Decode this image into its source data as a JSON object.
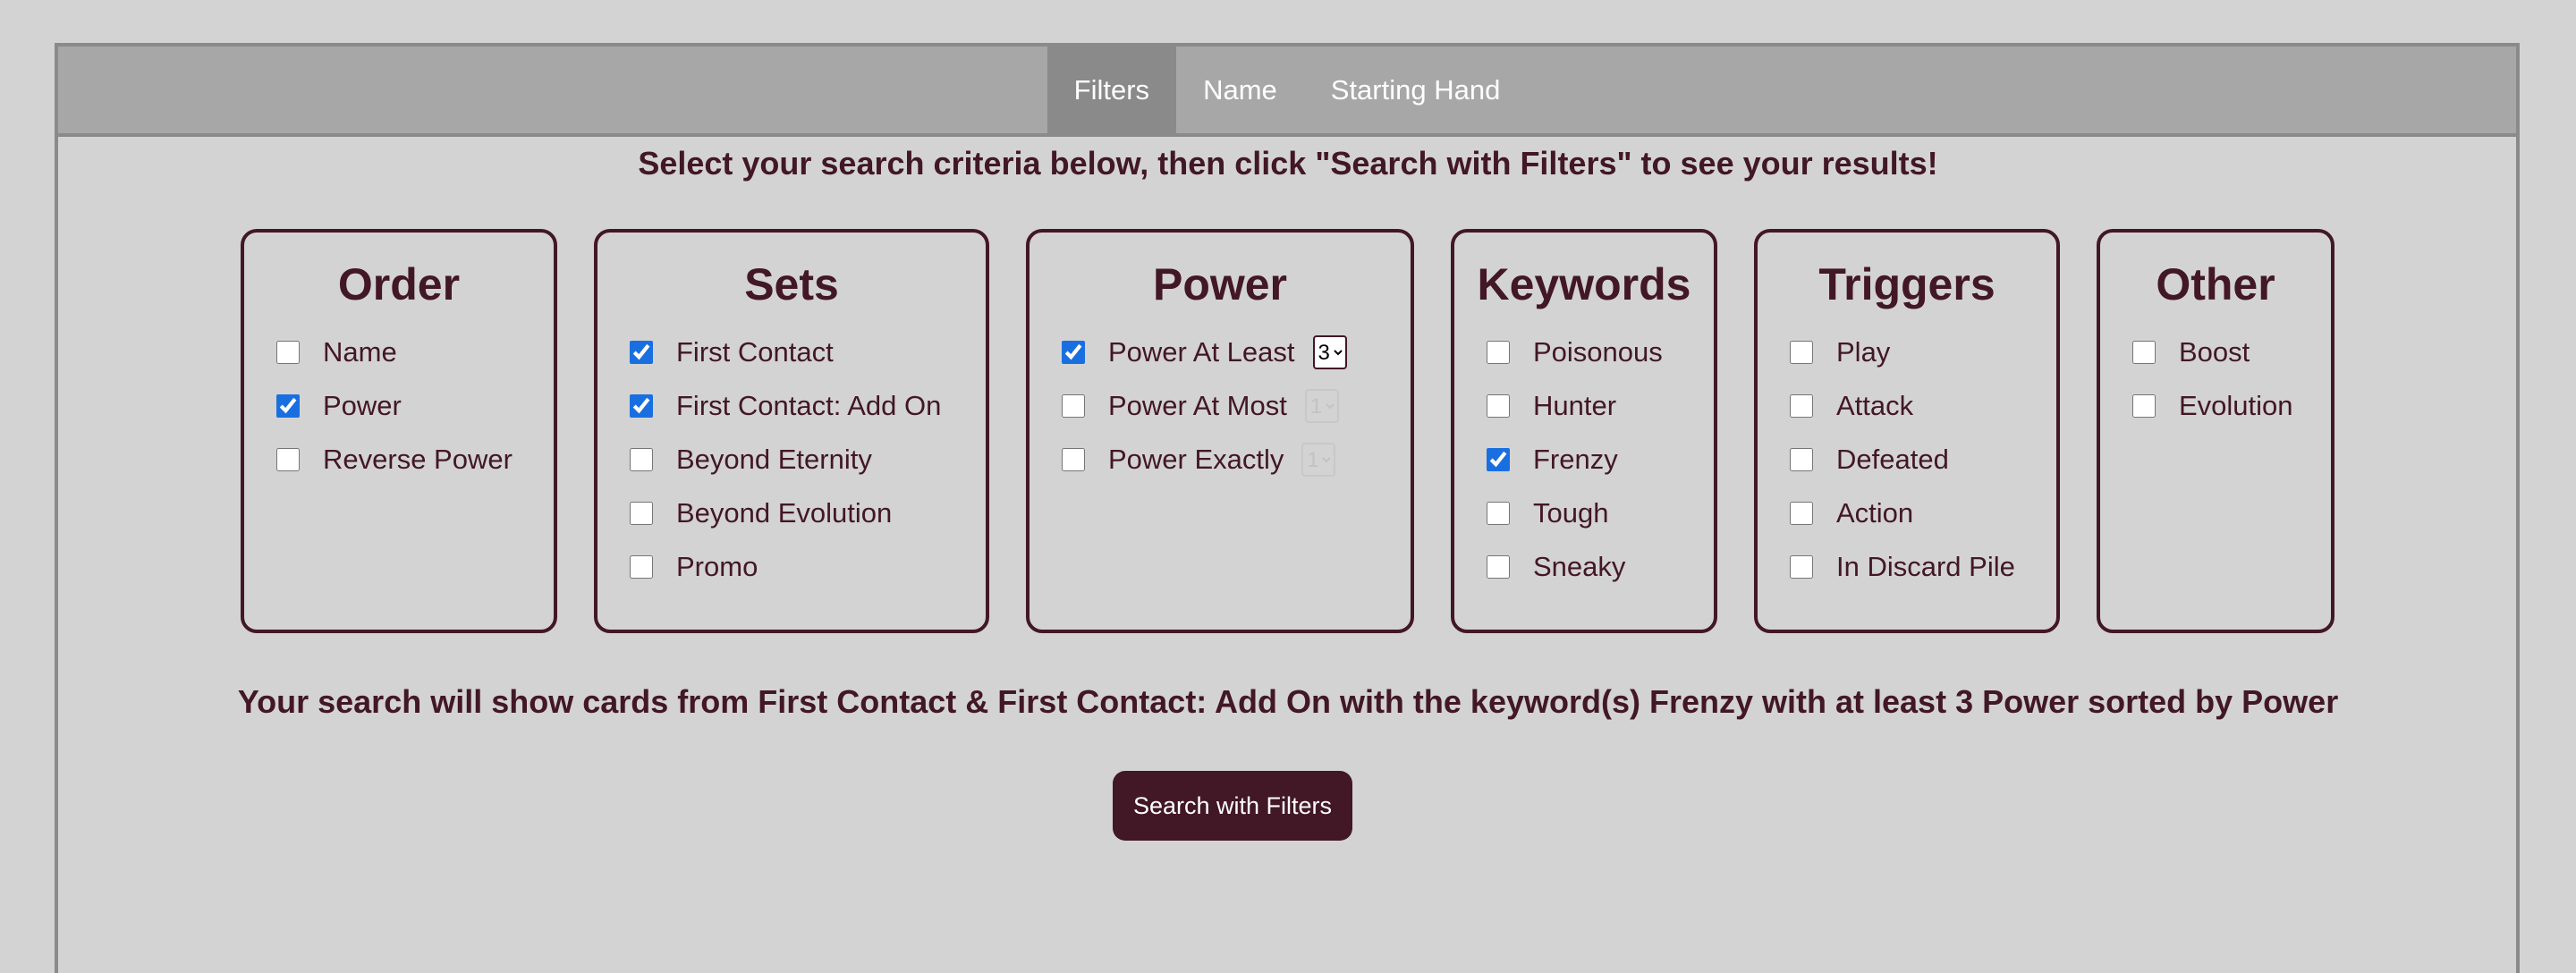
{
  "tabs": [
    {
      "label": "Filters",
      "active": true
    },
    {
      "label": "Name",
      "active": false
    },
    {
      "label": "Starting Hand",
      "active": false
    }
  ],
  "instructions": "Select your search criteria below, then click \"Search with Filters\" to see your results!",
  "panels": {
    "order": {
      "title": "Order",
      "options": [
        {
          "label": "Name",
          "checked": false
        },
        {
          "label": "Power",
          "checked": true
        },
        {
          "label": "Reverse Power",
          "checked": false
        }
      ]
    },
    "sets": {
      "title": "Sets",
      "options": [
        {
          "label": "First Contact",
          "checked": true
        },
        {
          "label": "First Contact: Add On",
          "checked": true
        },
        {
          "label": "Beyond Eternity",
          "checked": false
        },
        {
          "label": "Beyond Evolution",
          "checked": false
        },
        {
          "label": "Promo",
          "checked": false
        }
      ]
    },
    "power": {
      "title": "Power",
      "options": [
        {
          "label": "Power At Least",
          "checked": true,
          "select_value": "3"
        },
        {
          "label": "Power At Most",
          "checked": false,
          "select_value": "1"
        },
        {
          "label": "Power Exactly",
          "checked": false,
          "select_value": "1"
        }
      ]
    },
    "keywords": {
      "title": "Keywords",
      "options": [
        {
          "label": "Poisonous",
          "checked": false
        },
        {
          "label": "Hunter",
          "checked": false
        },
        {
          "label": "Frenzy",
          "checked": true
        },
        {
          "label": "Tough",
          "checked": false
        },
        {
          "label": "Sneaky",
          "checked": false
        }
      ]
    },
    "triggers": {
      "title": "Triggers",
      "options": [
        {
          "label": "Play",
          "checked": false
        },
        {
          "label": "Attack",
          "checked": false
        },
        {
          "label": "Defeated",
          "checked": false
        },
        {
          "label": "Action",
          "checked": false
        },
        {
          "label": "In Discard Pile",
          "checked": false
        }
      ]
    },
    "other": {
      "title": "Other",
      "options": [
        {
          "label": "Boost",
          "checked": false
        },
        {
          "label": "Evolution",
          "checked": false
        }
      ]
    }
  },
  "summary": "Your search will show cards from First Contact & First Contact: Add On with the keyword(s) Frenzy with at least 3 Power sorted by Power",
  "search_button_label": "Search with Filters",
  "colors": {
    "background": "#d3d3d3",
    "tabbar": "#a7a7a7",
    "active_tab": "#8a8a8a",
    "accent": "#421726",
    "checkbox": "#1a6fe0"
  }
}
